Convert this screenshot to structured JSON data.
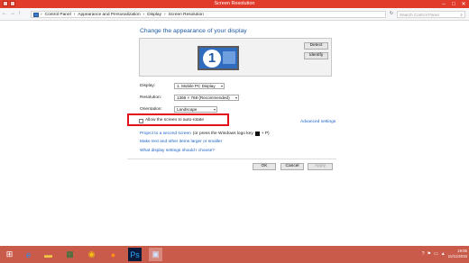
{
  "window": {
    "title": "Screen Resolution",
    "controls": [
      "–",
      "□",
      "✕"
    ]
  },
  "address": {
    "breadcrumbs": [
      "Control Panel",
      "Appearance and Personalization",
      "Display",
      "Screen Resolution"
    ],
    "separator": "›",
    "search_placeholder": "Search Control Panel",
    "refresh_glyph": "↻"
  },
  "main": {
    "heading": "Change the appearance of your display",
    "monitor_number": "1",
    "detect_label": "Detect",
    "identify_label": "Identify",
    "display_label": "Display:",
    "display_value": "1. Mobile PC Display",
    "resolution_label": "Resolution:",
    "resolution_value": "1366 × 768 (Recommended)",
    "orientation_label": "Orientation:",
    "orientation_value": "Landscape",
    "autorotate_label": "Allow the screen to auto-rotate",
    "autorotate_checked": false,
    "advanced_link": "Advanced settings",
    "project_link": "Project to a second screen",
    "project_hint": "(or press the Windows logo key",
    "project_hint_end": "+ P)",
    "text_size_link": "Make text and other items larger or smaller",
    "choose_link": "What display settings should I choose?"
  },
  "footer": {
    "ok_label": "OK",
    "cancel_label": "Cancel",
    "apply_label": "Apply"
  },
  "taskbar": {
    "apps": [
      "start-icon",
      "ie-icon",
      "explorer-icon",
      "excel-icon",
      "chrome-icon",
      "firefox-icon",
      "photoshop-icon",
      "control-panel-icon"
    ],
    "time": "19:05",
    "date": "11/11/2015",
    "colors": {
      "taskbar": "#c95b4a",
      "titlebar": "#e03b2b",
      "link": "#1b62c4"
    }
  }
}
